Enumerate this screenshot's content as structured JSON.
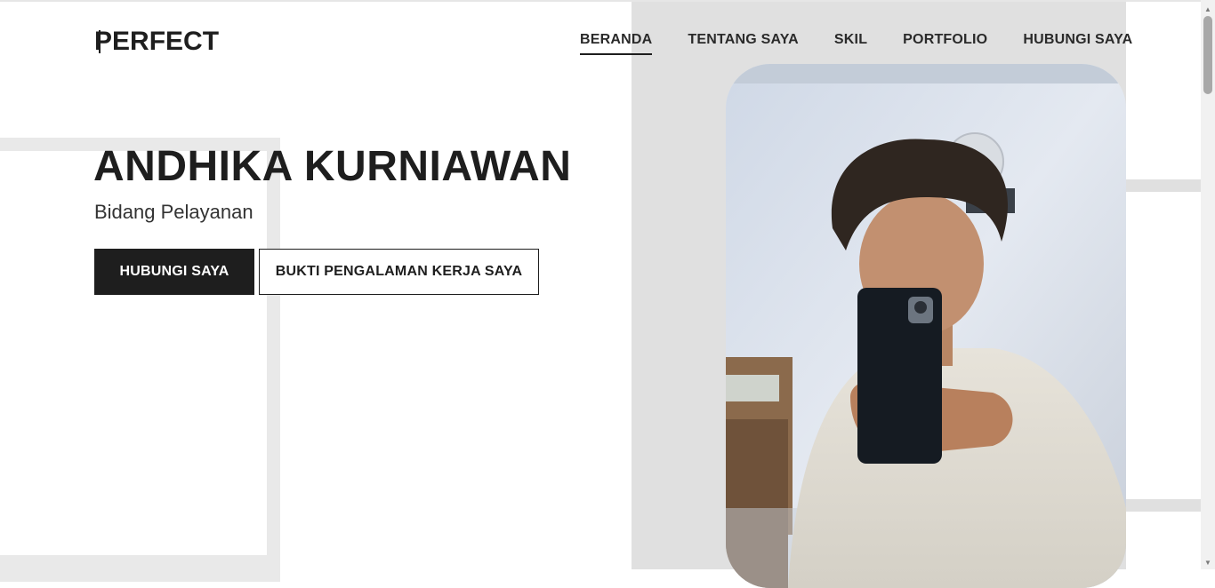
{
  "logo": {
    "first": "P",
    "rest": "ERFECT"
  },
  "nav": {
    "items": [
      {
        "label": "BERANDA",
        "active": true
      },
      {
        "label": "TENTANG SAYA",
        "active": false
      },
      {
        "label": "SKIL",
        "active": false
      },
      {
        "label": "PORTFOLIO",
        "active": false
      },
      {
        "label": "HUBUNGI SAYA",
        "active": false
      }
    ]
  },
  "hero": {
    "name": "ANDHIKA KURNIAWAN",
    "role": "Bidang Pelayanan",
    "primary_button": "HUBUNGI SAYA",
    "secondary_button": "BUKTI PENGALAMAN KERJA SAYA"
  },
  "colors": {
    "dark": "#1e1e1e",
    "panel": "#e0e0e0",
    "deco": "#e9e9e9"
  },
  "icons": {
    "scroll_up": "chevron-up-icon",
    "scroll_down": "chevron-down-icon"
  }
}
